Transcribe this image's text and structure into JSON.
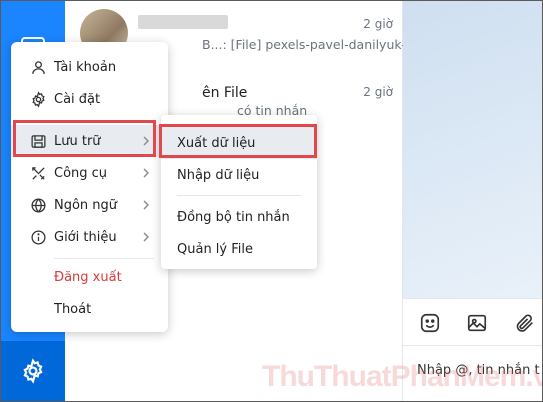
{
  "conversations": [
    {
      "preview": "B...: [File] pexels-pavel-danilyuk-...",
      "time": "2 giờ"
    },
    {
      "title": "ên File",
      "preview": "có tin nhắn",
      "time": "2 giờ"
    }
  ],
  "menu": {
    "items": [
      {
        "label": "Tài khoản",
        "icon": "user-icon"
      },
      {
        "label": "Cài đặt",
        "icon": "gear-icon"
      },
      {
        "label": "Lưu trữ",
        "icon": "storage-icon",
        "has_submenu": true
      },
      {
        "label": "Công cụ",
        "icon": "tools-icon",
        "has_submenu": true
      },
      {
        "label": "Ngôn ngữ",
        "icon": "globe-icon",
        "has_submenu": true
      },
      {
        "label": "Giới thiệu",
        "icon": "info-icon",
        "has_submenu": true
      }
    ],
    "logout_label": "Đăng xuất",
    "quit_label": "Thoát"
  },
  "submenu": {
    "items": [
      {
        "label": "Xuất dữ liệu"
      },
      {
        "label": "Nhập dữ liệu"
      },
      {
        "label": "Đồng bộ tin nhắn"
      },
      {
        "label": "Quản lý File"
      }
    ]
  },
  "chat": {
    "input_placeholder": "Nhập @, tin nhắn t"
  },
  "watermark": "ThuThuatPhanMem.vn",
  "colors": {
    "rail": "#1a85ff",
    "rail_active": "#0068d9",
    "highlight": "#e0484d",
    "logout": "#d93a3a"
  }
}
